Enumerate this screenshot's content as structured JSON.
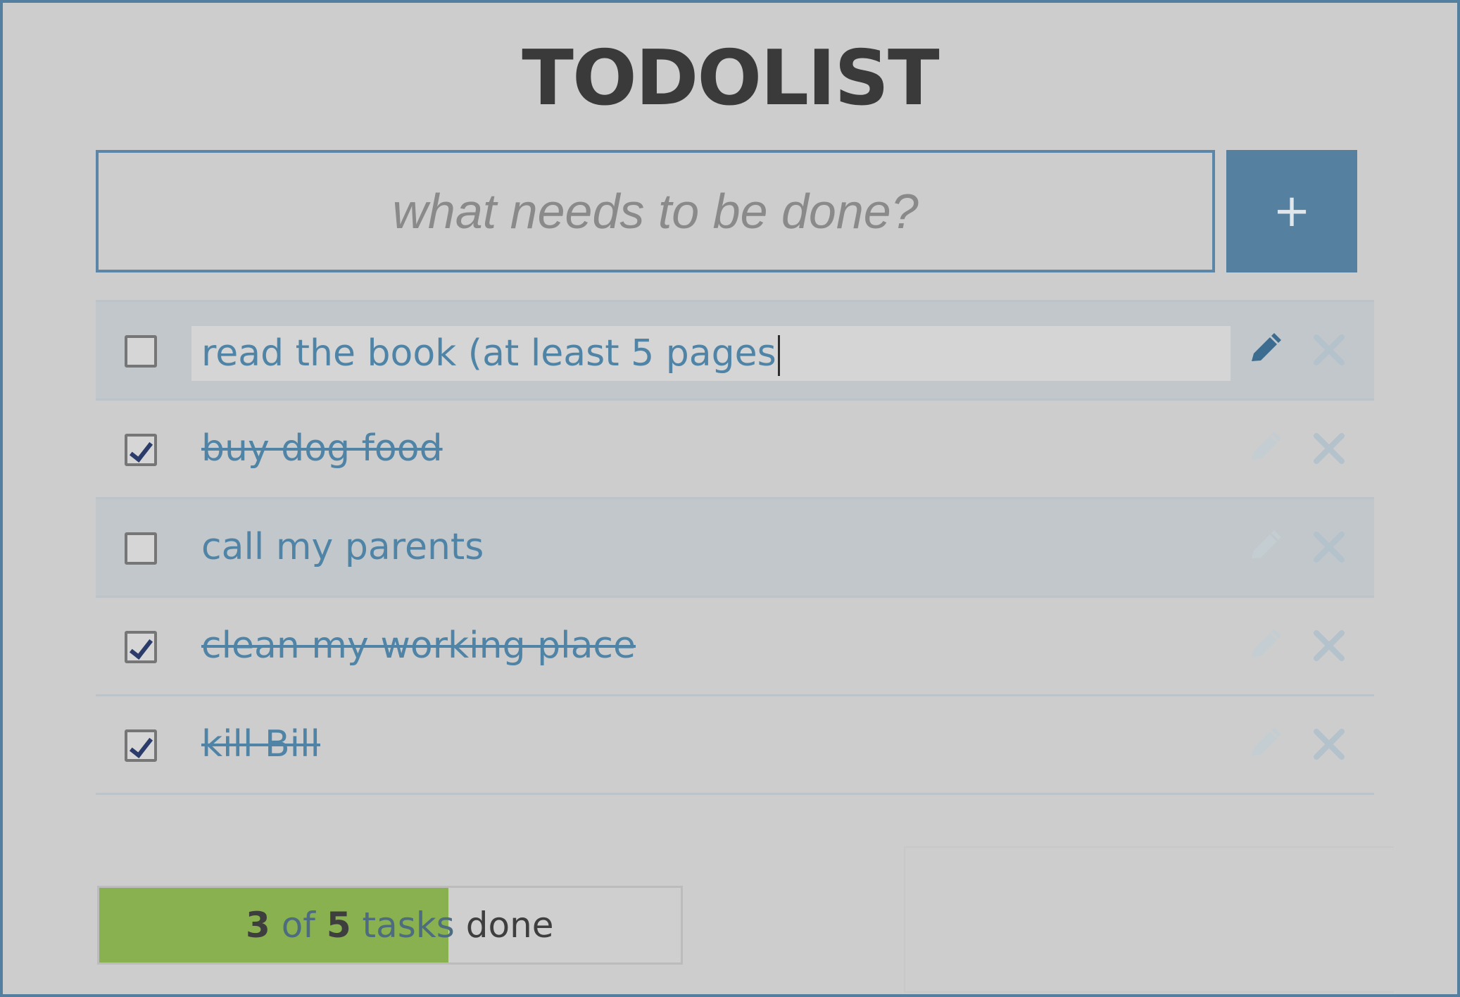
{
  "app": {
    "title": "TODOLIST"
  },
  "new_task": {
    "placeholder": "what needs to be done?",
    "value": "",
    "add_label": "+"
  },
  "tasks": [
    {
      "text": "read the book (at least 5 pages",
      "done": false,
      "editing": true
    },
    {
      "text": "buy dog food",
      "done": true,
      "editing": false
    },
    {
      "text": "call my parents",
      "done": false,
      "editing": false
    },
    {
      "text": "clean my working place",
      "done": true,
      "editing": false
    },
    {
      "text": "kill Bill",
      "done": true,
      "editing": false
    }
  ],
  "progress": {
    "done_count": "3",
    "of_label": "of",
    "total_count": "5",
    "tasks_label": "tasks",
    "done_label": "done",
    "fraction": 0.6
  },
  "colors": {
    "accent": "#56809f",
    "task_text": "#4f84a6",
    "progress_fill": "#89b14f"
  },
  "icons": {
    "edit": "pencil-icon",
    "delete": "close-icon"
  }
}
